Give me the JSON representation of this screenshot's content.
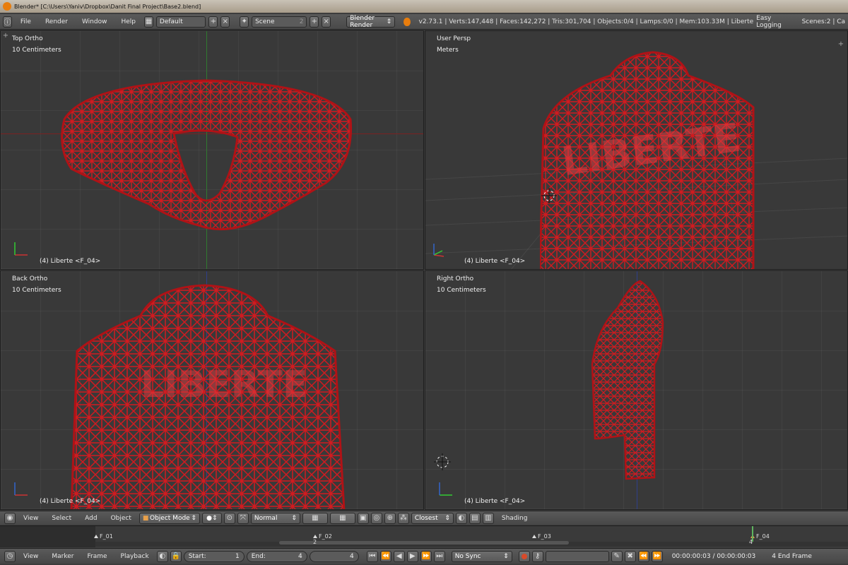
{
  "titlebar": {
    "title": "Blender* [C:\\Users\\Yaniv\\Dropbox\\Danit Final Project\\Base2.blend]"
  },
  "menubar": {
    "items": [
      "File",
      "Render",
      "Window",
      "Help"
    ],
    "layout": "Default",
    "scene": "Scene",
    "scene_count": "2",
    "render_engine": "Blender Render",
    "stats": "v2.73.1 | Verts:147,448 | Faces:142,272 | Tris:301,704 | Objects:0/4 | Lamps:0/0 | Mem:103.33M | Liberte",
    "addon": "Easy Logging",
    "scenes": "Scenes:2 | Ca"
  },
  "viewports": [
    {
      "view": "Top Ortho",
      "units": "10 Centimeters",
      "object": "(4) Liberte <F_04>"
    },
    {
      "view": "User Persp",
      "units": "Meters",
      "object": "(4) Liberte <F_04>"
    },
    {
      "view": "Back Ortho",
      "units": "10 Centimeters",
      "object": "(4) Liberte <F_04>"
    },
    {
      "view": "Right Ortho",
      "units": "10 Centimeters",
      "object": "(4) Liberte <F_04>"
    }
  ],
  "view3d_header": {
    "menus": [
      "View",
      "Select",
      "Add",
      "Object"
    ],
    "mode": "Object Mode",
    "pivot": "Normal",
    "snap": "Closest",
    "shading": "Shading"
  },
  "timeline": {
    "markers": [
      "F_01",
      "F_02",
      "F_03",
      "F_04"
    ],
    "frame_labels": [
      "2",
      "4"
    ],
    "menus": [
      "View",
      "Marker",
      "Frame",
      "Playback"
    ],
    "start_label": "Start:",
    "start_value": "1",
    "end_label": "End:",
    "end_value": "4",
    "current_frame": "4",
    "sync": "No Sync",
    "time": "00:00:00:03 / 00:00:00:03",
    "end_frame": "4 End Frame"
  },
  "colors": {
    "mesh": "#c0141a",
    "viewport_bg": "#393939",
    "header": "#4f4f4f"
  }
}
